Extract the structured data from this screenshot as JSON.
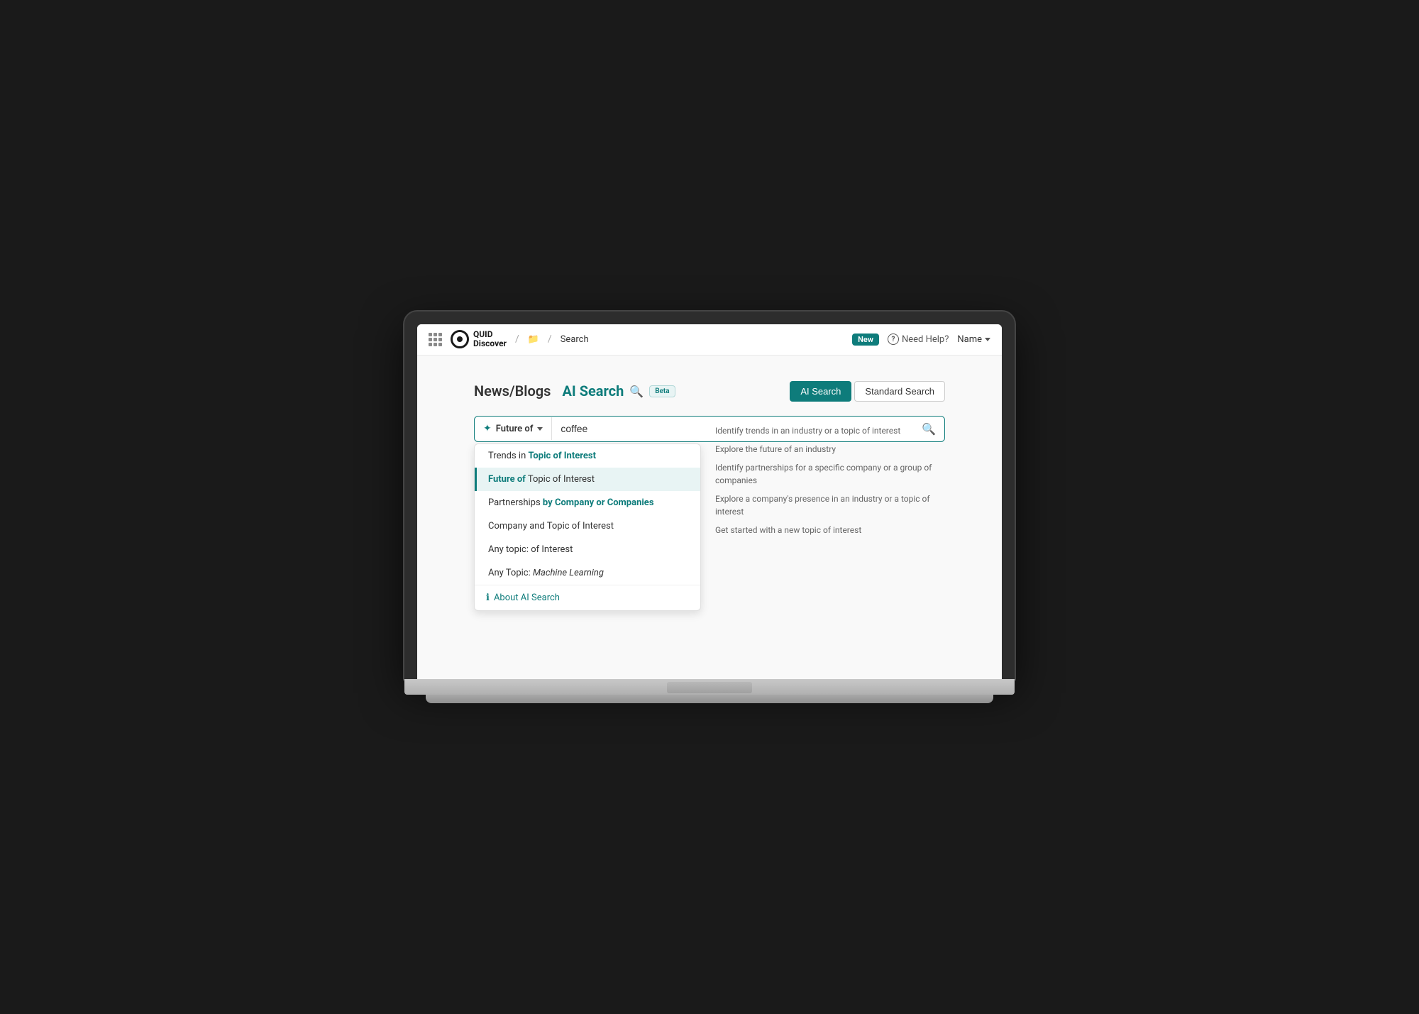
{
  "topbar": {
    "logo_name": "QUID\nDiscover",
    "breadcrumb_folder": "📁",
    "breadcrumb_page": "Search",
    "new_label": "New",
    "help_label": "Need Help?",
    "name_label": "Name"
  },
  "page": {
    "title_newsblogs": "News/Blogs",
    "title_ai": "AI Search",
    "title_beta": "Beta",
    "ai_search_btn": "AI Search",
    "standard_search_btn": "Standard Search"
  },
  "search_bar": {
    "type_prefix": "Future of",
    "input_value": "coffee",
    "input_placeholder": "coffee"
  },
  "dropdown": {
    "items": [
      {
        "label": "Trends in Topic of Interest",
        "highlight": "",
        "selected": false
      },
      {
        "label_before": "Future of ",
        "label_highlight": "Topic of Interest",
        "label_after": "",
        "selected": true
      },
      {
        "label_before": "Partnerships ",
        "label_highlight": "by Company or Companies",
        "label_after": "",
        "selected": false
      },
      {
        "label": "Company and Topic of Interest",
        "highlight": "",
        "selected": false
      },
      {
        "label": "Any topic: of Interest",
        "highlight": "",
        "selected": false
      },
      {
        "label_before": "Any Topic: ",
        "italic": "Machine Learning",
        "selected": false
      }
    ],
    "about_label": "About AI Search"
  },
  "hints": [
    "Identify trends in an industry or a topic of interest",
    "Explore the future of an industry",
    "Identify partnerships for a specific company or a group of companies",
    "Explore a company's presence in an industry or a topic of interest",
    "Get started with a new topic of interest"
  ]
}
